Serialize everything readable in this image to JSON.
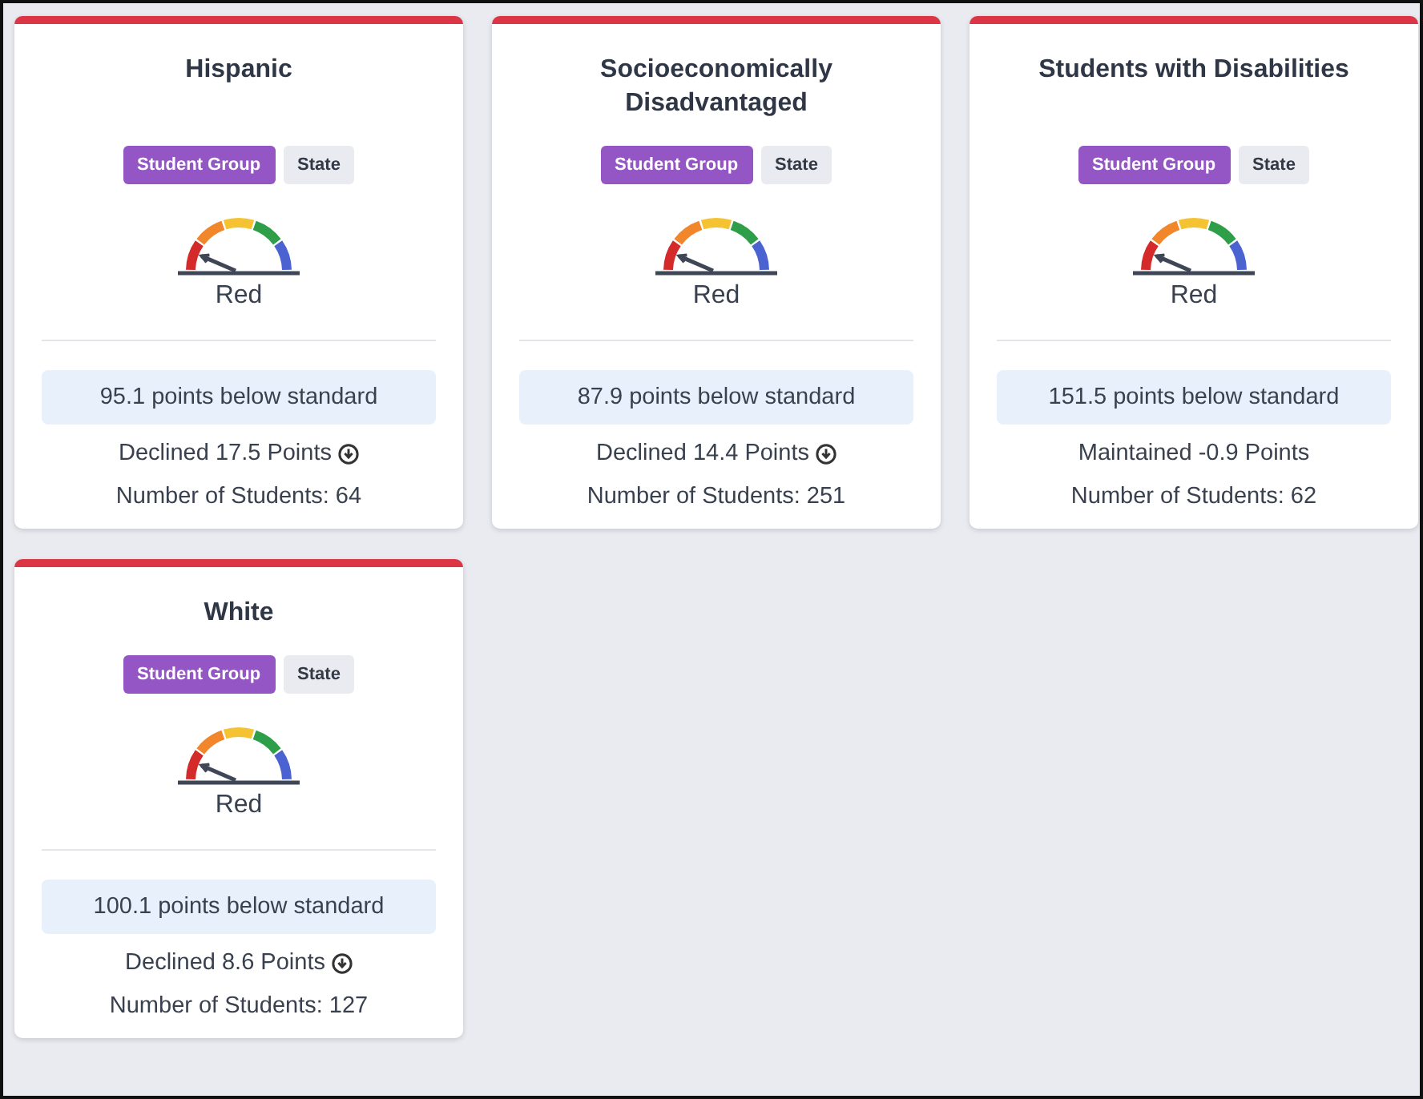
{
  "cards": [
    {
      "title": "Hispanic",
      "color": "#dc3545",
      "tabs": [
        {
          "label": "Student Group",
          "selected": true
        },
        {
          "label": "State",
          "selected": false
        }
      ],
      "status": "Red",
      "points": "95.1 points below standard",
      "change": {
        "kind": "declined",
        "text": "Declined 17.5 Points"
      },
      "students": "Number of Students: 64"
    },
    {
      "title": "Socioeconomically Disadvantaged",
      "color": "#dc3545",
      "tabs": [
        {
          "label": "Student Group",
          "selected": true
        },
        {
          "label": "State",
          "selected": false
        }
      ],
      "status": "Red",
      "points": "87.9 points below standard",
      "change": {
        "kind": "declined",
        "text": "Declined 14.4 Points"
      },
      "students": "Number of Students: 251"
    },
    {
      "title": "Students with Disabilities",
      "color": "#dc3545",
      "tabs": [
        {
          "label": "Student Group",
          "selected": true
        },
        {
          "label": "State",
          "selected": false
        }
      ],
      "status": "Red",
      "points": "151.5 points below standard",
      "change": {
        "kind": "maintained",
        "text": "Maintained -0.9 Points"
      },
      "students": "Number of Students: 62"
    },
    {
      "title": "White",
      "color": "#dc3545",
      "tabs": [
        {
          "label": "Student Group",
          "selected": true
        },
        {
          "label": "State",
          "selected": false
        }
      ],
      "status": "Red",
      "points": "100.1 points below standard",
      "change": {
        "kind": "declined",
        "text": "Declined 8.6 Points"
      },
      "students": "Number of Students: 127"
    }
  ]
}
